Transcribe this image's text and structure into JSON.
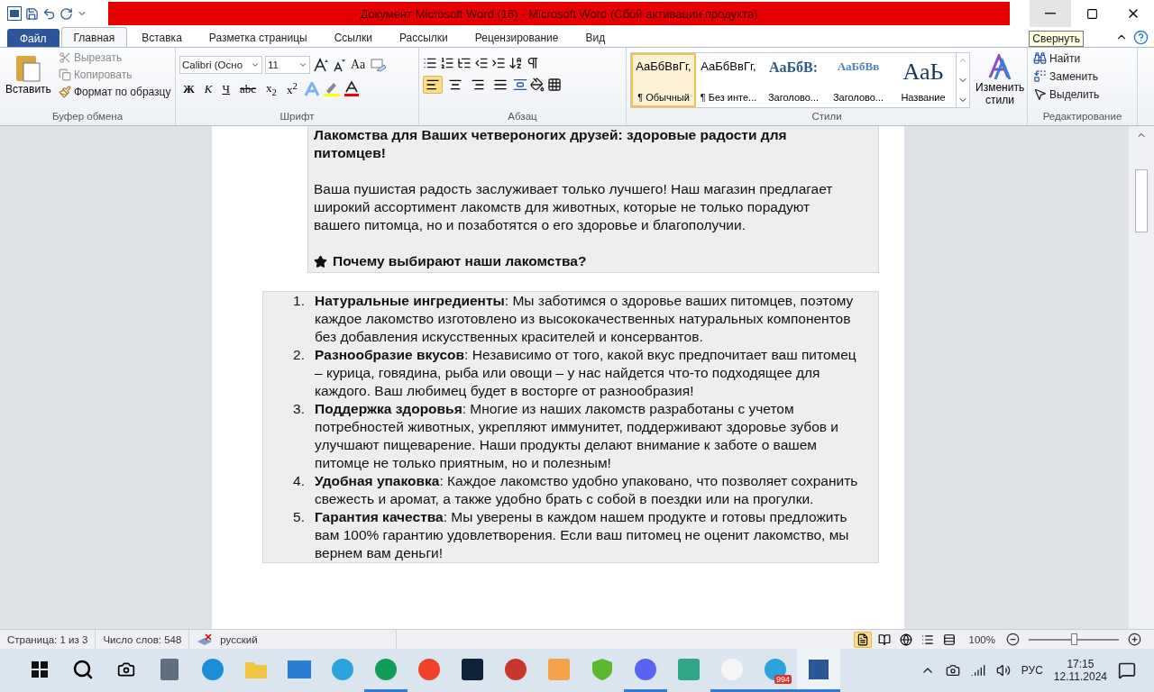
{
  "window": {
    "title": "Документ Microsoft Word (16)  -  Microsoft Word (Сбой активации продукта)",
    "tooltip": "Свернуть"
  },
  "tabs": [
    {
      "label": "Файл",
      "kind": "file",
      "selected": false
    },
    {
      "label": "Главная",
      "kind": "tab",
      "selected": true
    },
    {
      "label": "Вставка",
      "kind": "tab",
      "selected": false
    },
    {
      "label": "Разметка страницы",
      "kind": "tab",
      "selected": false
    },
    {
      "label": "Ссылки",
      "kind": "tab",
      "selected": false
    },
    {
      "label": "Рассылки",
      "kind": "tab",
      "selected": false
    },
    {
      "label": "Рецензирование",
      "kind": "tab",
      "selected": false
    },
    {
      "label": "Вид",
      "kind": "tab",
      "selected": false
    }
  ],
  "clipboard": {
    "label": "Буфер обмена",
    "paste": "Вставить",
    "items": [
      {
        "label": "Вырезать",
        "kind": "cut",
        "disabled": true
      },
      {
        "label": "Копировать",
        "kind": "copy",
        "disabled": true
      },
      {
        "label": "Формат по образцу",
        "kind": "brush",
        "disabled": false
      }
    ]
  },
  "font": {
    "label": "Шрифт",
    "font_name": "Calibri (Осно",
    "font_size": "11",
    "case_button": "Aa",
    "format_buttons": [
      {
        "text": "Ж",
        "kind": "bold"
      },
      {
        "text": "К",
        "kind": "italic"
      },
      {
        "text": "Ч",
        "kind": "underline"
      },
      {
        "text": "abc",
        "kind": "strike"
      },
      {
        "text": "x$_{2}$",
        "kind": "plain"
      },
      {
        "text": "x$^{2}$",
        "kind": "plain"
      }
    ]
  },
  "paragraph": {
    "label": "Абзац",
    "align": [
      {
        "kind": "left",
        "selected": true
      },
      {
        "kind": "center",
        "selected": false
      },
      {
        "kind": "right",
        "selected": false
      },
      {
        "kind": "justify",
        "selected": false
      }
    ]
  },
  "styles": {
    "label": "Стили",
    "items": [
      {
        "preview": "АаБбВвГг,",
        "name": "¶ Обычный",
        "kind": "normal",
        "selected": true
      },
      {
        "preview": "АаБбВвГг,",
        "name": "¶ Без инте...",
        "kind": "normal",
        "selected": false
      },
      {
        "preview": "АаБбВ:",
        "name": "Заголово...",
        "kind": "heading1",
        "selected": false
      },
      {
        "preview": "АаБбВв",
        "name": "Заголово...",
        "kind": "heading2",
        "selected": false
      },
      {
        "preview": "АаЬ",
        "name": "Название",
        "kind": "title",
        "selected": false
      }
    ],
    "change": "Изменить стили"
  },
  "editing": {
    "label": "Редактирование",
    "items": [
      {
        "label": "Найти",
        "kind": "find"
      },
      {
        "label": "Заменить",
        "kind": "replace"
      },
      {
        "label": "Выделить",
        "kind": "select"
      }
    ]
  },
  "document": {
    "heading": "Лакомства для Ваших четвероногих друзей: здоровые радости для питомцев!",
    "intro": "Ваша пушистая радость заслуживает только лучшего! Наш магазин предлагает широкий ассортимент лакомств для животных, которые не только порадуют вашего питомца, но и позаботятся о его здоровье и благополучии.",
    "subheading": "Почему выбирают наши лакомства?",
    "list": [
      {
        "number": "1.",
        "text": "**Натуральные ингредиенты**: Мы заботимся о здоровье ваших питомцев, поэтому каждое лакомство изготовлено из высококачественных натуральных компонентов без добавления искусственных красителей и консервантов."
      },
      {
        "number": "2.",
        "text": "**Разнообразие вкусов**: Независимо от того, какой вкус предпочитает ваш питомец – курица, говядина, рыба или овощи – у нас найдется что-то подходящее для каждого. Ваш любимец будет в восторге от разнообразия!"
      },
      {
        "number": "3.",
        "text": "**Поддержка здоровья**: Многие из наших лакомств разработаны с учетом потребностей животных, укрепляют иммунитет, поддерживают здоровье зубов и улучшают пищеварение. Наши продукты делают внимание к заботе о вашем питомце не только приятным, но и полезным!"
      },
      {
        "number": "4.",
        "text": "**Удобная упаковка**: Каждое лакомство удобно упаковано, что позволяет сохранить свежесть и аромат, а также удобно брать с собой в поездки или на прогулки."
      },
      {
        "number": "5.",
        "text": "**Гарантия качества**: Мы уверены в каждом нашем продукте и готовы предложить вам 100% гарантию удовлетворения. Если ваш питомец не оценит лакомство, мы вернем вам деньги!"
      }
    ]
  },
  "status_bar": {
    "page": "Страница: 1 из 3",
    "words": "Число слов: 548",
    "language": "русский",
    "zoom": "100%",
    "zoom_slider": {
      "level": 0.5
    },
    "views": [
      {
        "kind": "print",
        "selected": true
      },
      {
        "kind": "read",
        "selected": false
      },
      {
        "kind": "web",
        "selected": false
      },
      {
        "kind": "outline",
        "selected": false
      },
      {
        "kind": "draft",
        "selected": false
      }
    ]
  },
  "taskbar": {
    "apps": [
      {
        "kind": "calc",
        "color": "#607080",
        "running": false
      },
      {
        "kind": "circle",
        "color": "#1a8fd8",
        "running": false
      },
      {
        "kind": "folder",
        "color": "#f4c542",
        "running": false
      },
      {
        "kind": "mail",
        "color": "#2a7fd4",
        "running": false
      },
      {
        "kind": "circle",
        "color": "#2aa3df",
        "running": false
      },
      {
        "kind": "circle",
        "color": "#0f9d58",
        "running": true
      },
      {
        "kind": "circle",
        "color": "#f0412a",
        "running": false
      },
      {
        "kind": "square",
        "color": "#0b2239",
        "running": false
      },
      {
        "kind": "circle",
        "color": "#c8372a",
        "running": false
      },
      {
        "kind": "square",
        "color": "#f3a24a",
        "running": false
      },
      {
        "kind": "shield",
        "color": "#5cb82e",
        "running": false
      },
      {
        "kind": "circle",
        "color": "#5865f2",
        "running": true
      },
      {
        "kind": "square",
        "color": "#2fa88a",
        "running": false
      },
      {
        "kind": "circle",
        "color": "#f5f5f5",
        "running": true
      },
      {
        "kind": "circle",
        "color": "#2aa3df",
        "running": true,
        "badge": "994"
      },
      {
        "kind": "word",
        "color": "#2b5797",
        "running": true
      }
    ],
    "language": "РУС",
    "time": "17:15",
    "date": "12.11.2024"
  }
}
